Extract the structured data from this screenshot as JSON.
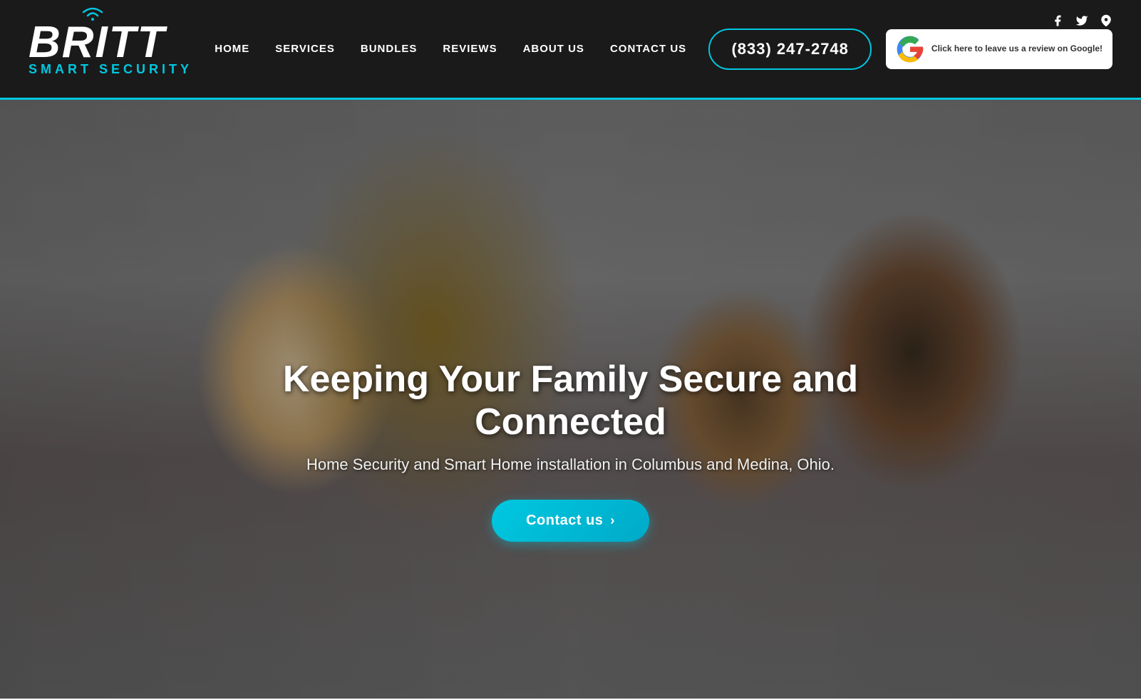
{
  "header": {
    "logo": {
      "brand": "BRITT",
      "tagline": "SMART SECURITY"
    },
    "nav": {
      "items": [
        {
          "label": "HOME",
          "id": "home"
        },
        {
          "label": "SERVICES",
          "id": "services"
        },
        {
          "label": "BUNDLES",
          "id": "bundles"
        },
        {
          "label": "REVIEWS",
          "id": "reviews"
        },
        {
          "label": "ABOUT US",
          "id": "about"
        },
        {
          "label": "CONTACT US",
          "id": "contact"
        }
      ]
    },
    "phone": "(833) 247-2748",
    "google_badge": {
      "text": "Click here to leave us a review on Google!"
    },
    "social": {
      "facebook_label": "f",
      "twitter_label": "t",
      "location_label": "📍"
    }
  },
  "hero": {
    "title": "Keeping Your Family Secure and Connected",
    "subtitle": "Home Security and Smart Home installation in Columbus and Medina, Ohio.",
    "cta_button": "Contact us",
    "cta_arrow": "›"
  }
}
